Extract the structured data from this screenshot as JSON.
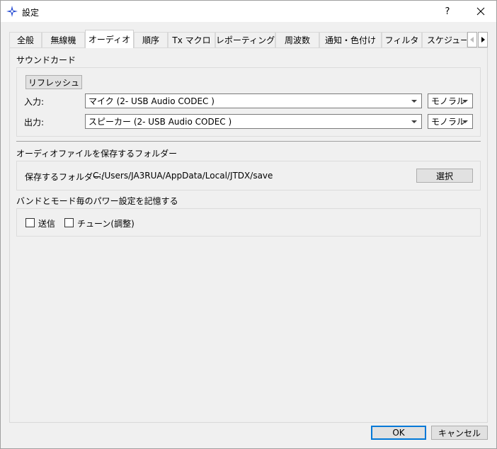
{
  "window": {
    "title": "設定",
    "help_label": "?"
  },
  "tabs": [
    {
      "label": "全般",
      "active": false
    },
    {
      "label": "無線機",
      "active": false
    },
    {
      "label": "オーディオ",
      "active": true
    },
    {
      "label": "順序",
      "active": false
    },
    {
      "label": "Tx マクロ",
      "active": false
    },
    {
      "label": "レポーティング",
      "active": false
    },
    {
      "label": "周波数",
      "active": false
    },
    {
      "label": "通知・色付け",
      "active": false
    },
    {
      "label": "フィルタ",
      "active": false
    },
    {
      "label": "スケジューラ",
      "active": false
    }
  ],
  "soundcard": {
    "section_title": "サウンドカード",
    "refresh_label": "リフレッシュ",
    "input_label": "入力:",
    "input_device": "マイク (2- USB Audio CODEC )",
    "input_channel": "モノラル",
    "output_label": "出力:",
    "output_device": "スピーカー (2- USB Audio CODEC )",
    "output_channel": "モノラル"
  },
  "save_folder": {
    "section_title": "オーディオファイルを保存するフォルダー",
    "label": "保存するフォルダー:",
    "path": "C:/Users/JA3RUA/AppData/Local/JTDX/save",
    "select_label": "選択"
  },
  "power": {
    "section_title": "バンドとモード毎のパワー設定を記憶する",
    "tx_label": "送信",
    "tx_checked": false,
    "tune_label": "チューン(調整)",
    "tune_checked": false
  },
  "footer": {
    "ok_label": "OK",
    "cancel_label": "キャンセル"
  }
}
